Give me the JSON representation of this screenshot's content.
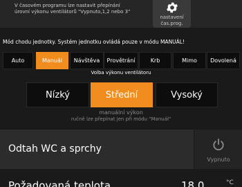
{
  "schedule_info": {
    "line1": "V časovém programu lze nastavit přepínání",
    "line2": "úrovní výkonu ventilátorů \"Vypnuto,1,2 nebo 3\""
  },
  "schedule_button": {
    "icon": "gear-icon",
    "label_line1": "nastavení",
    "label_line2": "čas.prog."
  },
  "mode_title": "Mód chodu jednotky. Systém jednotku ovládá pouze v módu MANUÁL!",
  "modes": [
    {
      "label": "Auto"
    },
    {
      "label": "Manuál",
      "active": true
    },
    {
      "label": "Návštěva"
    },
    {
      "label": "Provětrání"
    },
    {
      "label": "Krb"
    },
    {
      "label": "Mimo"
    },
    {
      "label": "Dovolená"
    }
  ],
  "fan_title": "Volba výkonu ventilátoru",
  "fan_levels": [
    {
      "label": "Nízký"
    },
    {
      "label": "Střední",
      "active": true
    },
    {
      "label": "Vysoký"
    }
  ],
  "fan_note": {
    "line1": "manuální výkon",
    "line2": "ručně lze přepínat jen při módu \"Manuál\""
  },
  "wc_panel": {
    "title": "Odtah WC a sprchy",
    "power_icon": "power-icon",
    "power_label": "Vypnuto"
  },
  "temperature": {
    "label": "Požadovaná teplota",
    "value": "18.0",
    "unit": "°C"
  },
  "colors": {
    "accent": "#f08d1e",
    "background": "#1a1a1a",
    "panel": "#2c2c2c",
    "button": "#0d0d0d"
  }
}
